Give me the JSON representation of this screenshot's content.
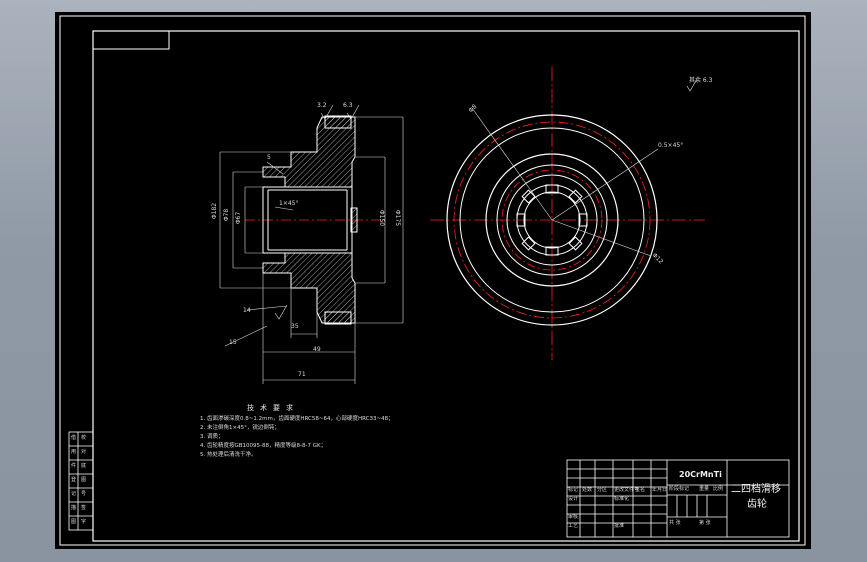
{
  "drawing": {
    "colors": {
      "background": "#000000",
      "outline": "#ffffff",
      "centerline": "#ff2020",
      "hatch": "#c8c8c8",
      "dimension": "#dcdcdc"
    },
    "section_view": {
      "dimensions": {
        "d182": "Φ182",
        "d78": "Φ78",
        "d67": "Φ67",
        "d150": "Φ150",
        "d175": "Φ175",
        "chamfer": "1×45°",
        "r5": "5",
        "r14": "14",
        "len_ref": "35",
        "len_body": "49",
        "len_total": "71",
        "mark_15": "15"
      },
      "roughness_marks": [
        "3.2",
        "6.3"
      ]
    },
    "front_view": {
      "labels": {
        "chamfer": "0.5×45°",
        "dia_upper": "Φ8",
        "dia_lower": "Φ12"
      }
    },
    "surface_finish_note": "其余 6.3",
    "technical_requirements": {
      "title": "技术要求",
      "lines": [
        "1. 齿面渗碳深度0.8~1.2mm，齿面硬度HRC58~64，心部硬度HRC33~48；",
        "2. 未注倒角1×45°，锐边倒钝；",
        "3. 调质；",
        "4. 齿轮精度按GB10095-88，精度等级8-8-7 GK；",
        "5. 热处理后清洗干净。"
      ]
    }
  },
  "title_block": {
    "material": "20CrMnTi",
    "part_name_line1": "二四档滑移",
    "part_name_line2": "齿轮",
    "cells": [
      "标记",
      "处数",
      "分区",
      "更改文件号",
      "签名",
      "年月日",
      "设计",
      "标准化",
      "审核",
      "工艺",
      "批准",
      "阶段标记",
      "重量",
      "比例",
      "共 张",
      "第 张"
    ],
    "left_strip": [
      "借",
      "用",
      "件",
      "登",
      "记",
      "描",
      "图",
      "校",
      "对",
      "底",
      "图",
      "号",
      "签",
      "字"
    ]
  }
}
